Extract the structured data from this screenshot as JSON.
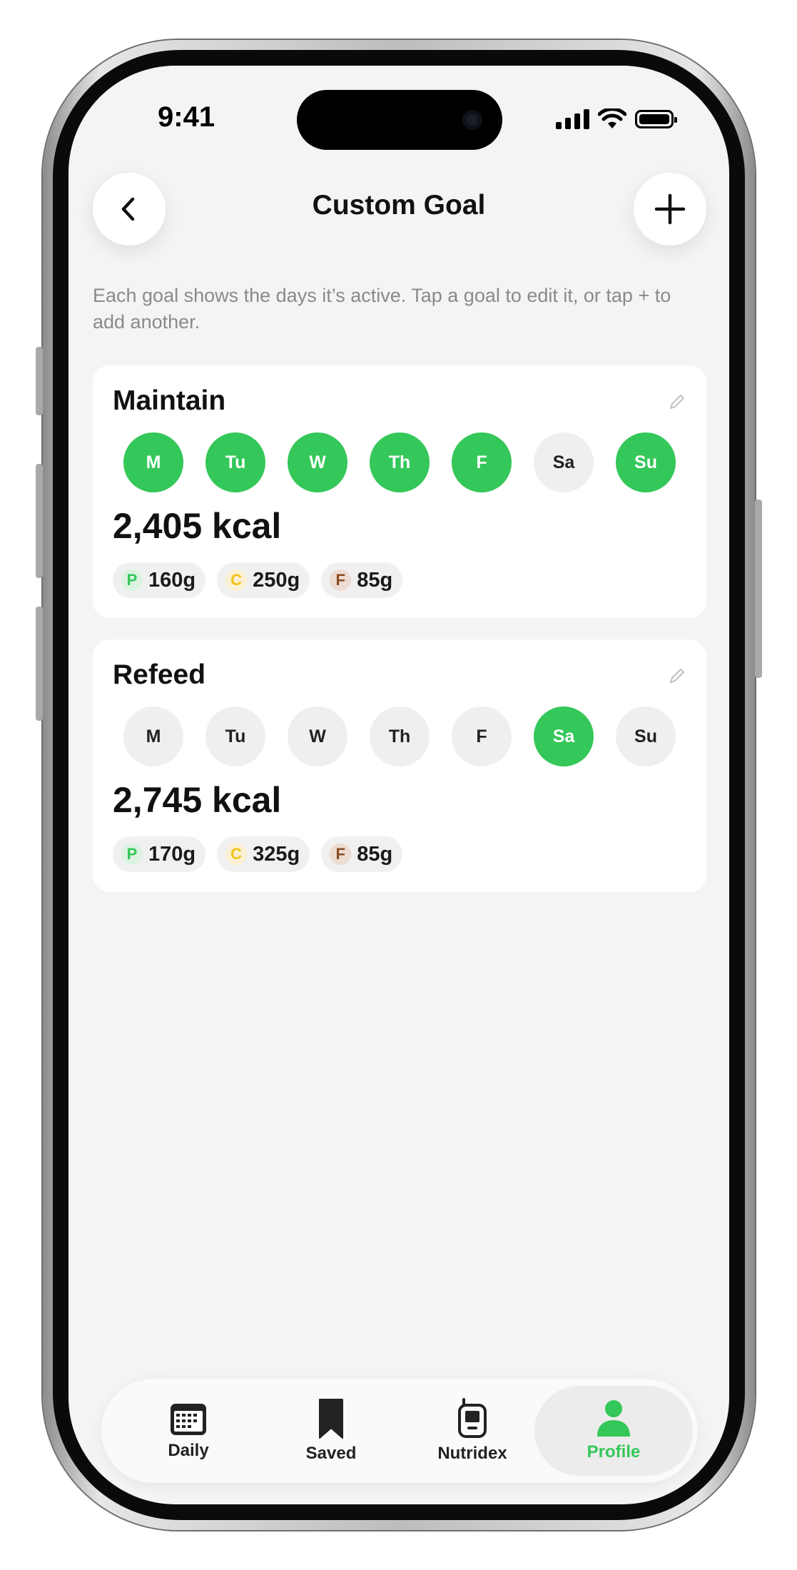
{
  "status_bar": {
    "time": "9:41"
  },
  "header": {
    "title": "Custom Goal"
  },
  "description": "Each goal shows the days it’s active. Tap a goal to edit it, or tap + to add another.",
  "colors": {
    "accent": "#34c759",
    "protein": "#34c759",
    "carbs": "#f2c21b",
    "fat": "#8a4a22"
  },
  "goals": [
    {
      "name": "Maintain",
      "days": [
        {
          "label": "M",
          "active": true
        },
        {
          "label": "Tu",
          "active": true
        },
        {
          "label": "W",
          "active": true
        },
        {
          "label": "Th",
          "active": true
        },
        {
          "label": "F",
          "active": true
        },
        {
          "label": "Sa",
          "active": false
        },
        {
          "label": "Su",
          "active": true
        }
      ],
      "kcal": "2,405 kcal",
      "macros": [
        {
          "letter": "P",
          "value": "160g"
        },
        {
          "letter": "C",
          "value": "250g"
        },
        {
          "letter": "F",
          "value": "85g"
        }
      ]
    },
    {
      "name": "Refeed",
      "days": [
        {
          "label": "M",
          "active": false
        },
        {
          "label": "Tu",
          "active": false
        },
        {
          "label": "W",
          "active": false
        },
        {
          "label": "Th",
          "active": false
        },
        {
          "label": "F",
          "active": false
        },
        {
          "label": "Sa",
          "active": true
        },
        {
          "label": "Su",
          "active": false
        }
      ],
      "kcal": "2,745 kcal",
      "macros": [
        {
          "letter": "P",
          "value": "170g"
        },
        {
          "letter": "C",
          "value": "325g"
        },
        {
          "letter": "F",
          "value": "85g"
        }
      ]
    }
  ],
  "tabbar": {
    "active": "Profile",
    "tabs": [
      {
        "label": "Daily",
        "icon": "calendar-icon"
      },
      {
        "label": "Saved",
        "icon": "bookmark-icon"
      },
      {
        "label": "Nutridex",
        "icon": "device-icon"
      },
      {
        "label": "Profile",
        "icon": "person-icon"
      }
    ]
  }
}
